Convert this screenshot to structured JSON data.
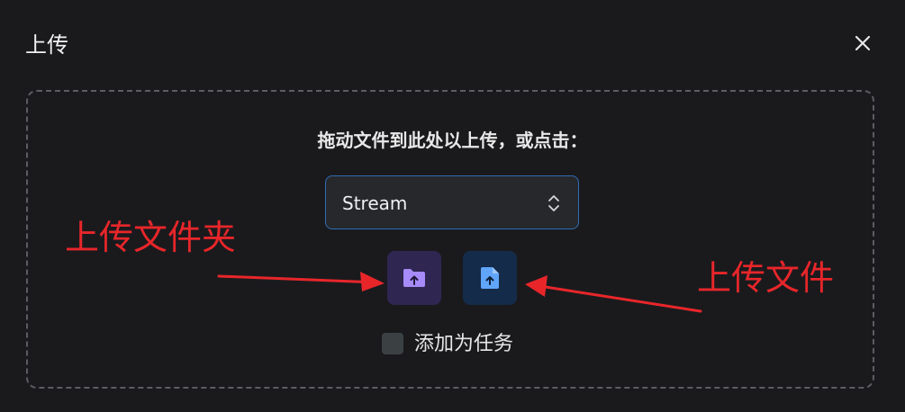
{
  "dialog": {
    "title": "上传",
    "close_icon": "close-icon"
  },
  "dropzone": {
    "hint": "拖动文件到此处以上传，或点击：",
    "select": {
      "value": "Stream",
      "icon": "chevron-up-down-icon"
    },
    "buttons": {
      "folder_icon": "folder-upload-icon",
      "file_icon": "file-upload-icon"
    },
    "checkbox": {
      "label": "添加为任务",
      "checked": false
    }
  },
  "annotations": {
    "left_label": "上传文件夹",
    "right_label": "上传文件",
    "color": "#e8262a"
  },
  "colors": {
    "background": "#1a1a1d",
    "folder_button": "#2f2651",
    "folder_icon": "#a78bfa",
    "file_button": "#142b49",
    "file_icon": "#60a5fa",
    "select_border": "#2f6db5"
  }
}
